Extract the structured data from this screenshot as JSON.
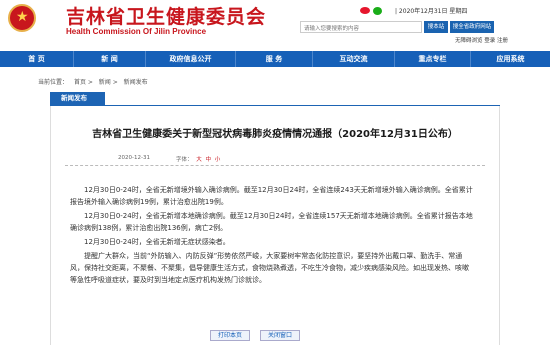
{
  "header": {
    "site_title": "吉林省卫生健康委员会",
    "site_subtitle": "Health Commission Of Jilin Province",
    "date": "| 2020年12月31日 星期四",
    "search_placeholder": "请输入您要搜索的内容",
    "search_button": "搜本站",
    "site_search_button": "搜全省政府网站",
    "accessibility": "无障碍浏览  登录  注册"
  },
  "nav": {
    "items": [
      "首 页",
      "新 闻",
      "政府信息公开",
      "服 务",
      "互动交流",
      "重点专栏",
      "应用系统"
    ]
  },
  "breadcrumb": {
    "items": [
      "当前位置：",
      "首页 >",
      "新闻 >",
      "新闻发布"
    ]
  },
  "section": {
    "tab_label": "新闻发布"
  },
  "article": {
    "title": "吉林省卫生健康委关于新型冠状病毒肺炎疫情情况通报（2020年12月31日公布）",
    "date": "2020-12-31",
    "font_label": "字体：",
    "font_large": "大",
    "font_medium": "中",
    "font_small": "小",
    "paragraphs": [
      "12月30日0-24时，全省无新增境外输入确诊病例。截至12月30日24时，全省连续243天无新增境外输入确诊病例。全省累计报告境外输入确诊病例19例，累计治愈出院19例。",
      "12月30日0-24时，全省无新增本地确诊病例。截至12月30日24时，全省连续157天无新增本地确诊病例。全省累计报告本地确诊病例138例，累计治愈出院136例，病亡2例。",
      "12月30日0-24时，全省无新增无症状感染者。",
      "提醒广大群众，当前“外防输入、内防反弹”形势依然严峻，大家要树牢常态化防控意识，要坚持外出戴口罩、勤洗手、常通风，保持社交距离，不聚餐、不聚集，倡导健康生活方式，食物烧熟煮透，不吃生冷食物，减少疾病感染风险。如出现发热、咳嗽等急性呼吸道症状，要及时到当地定点医疗机构发热门诊就诊。"
    ],
    "print_label": "打印本页",
    "close_label": "关闭窗口"
  },
  "colors": {
    "brand_red": "#c8161d",
    "nav_blue": "#1660b8"
  }
}
